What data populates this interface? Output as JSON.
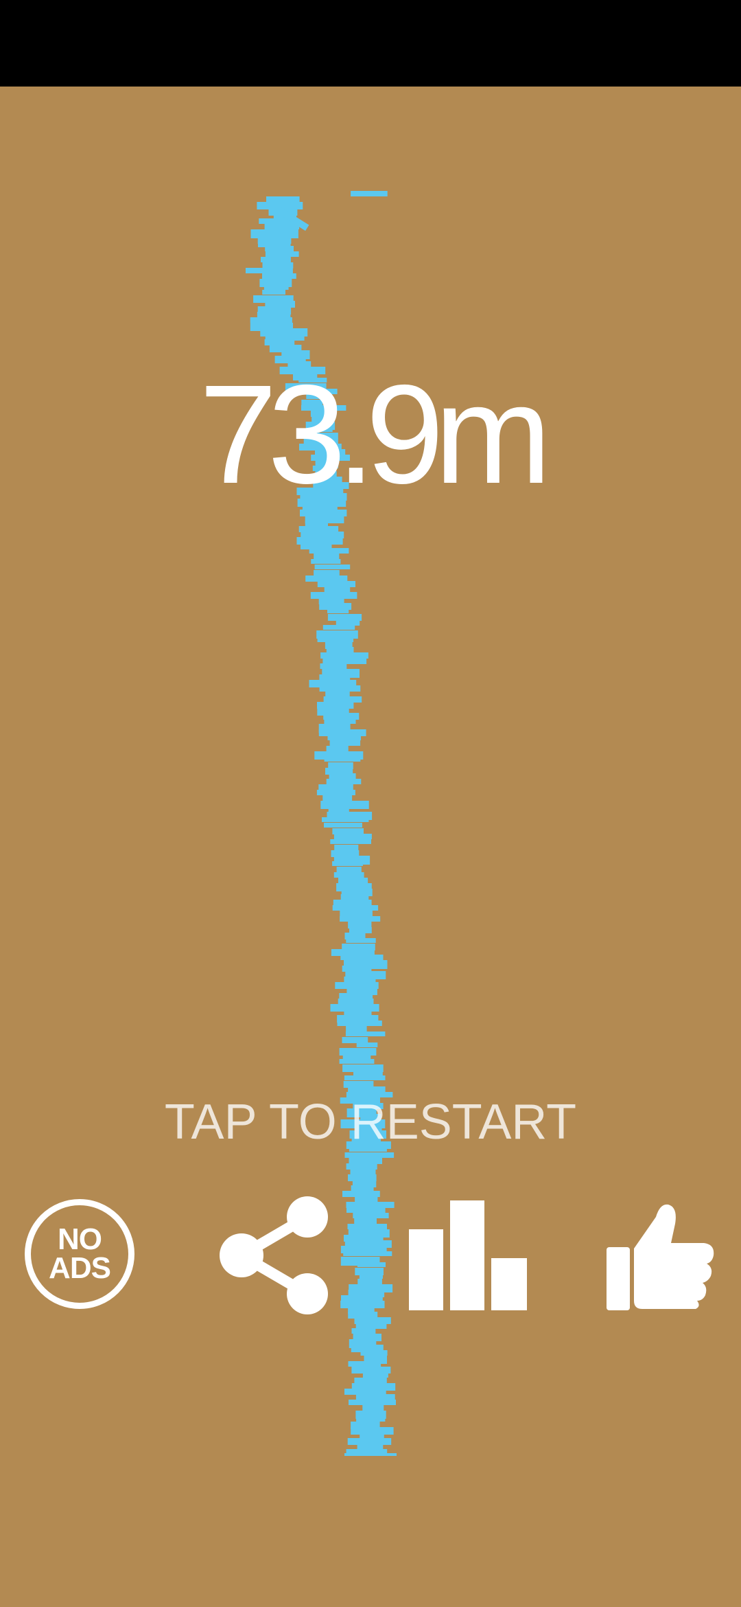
{
  "score": {
    "value": "73.9m"
  },
  "prompt": {
    "restart": "TAP TO RESTART"
  },
  "buttons": {
    "no_ads_line1": "NO",
    "no_ads_line2": "ADS",
    "share_icon": "share-icon",
    "leaderboard_icon": "bar-chart-icon",
    "rate_icon": "thumbs-up-icon"
  },
  "colors": {
    "background": "#b38a52",
    "blocks": "#5bc8f0",
    "text": "#ffffff",
    "status_bar": "#000000"
  }
}
